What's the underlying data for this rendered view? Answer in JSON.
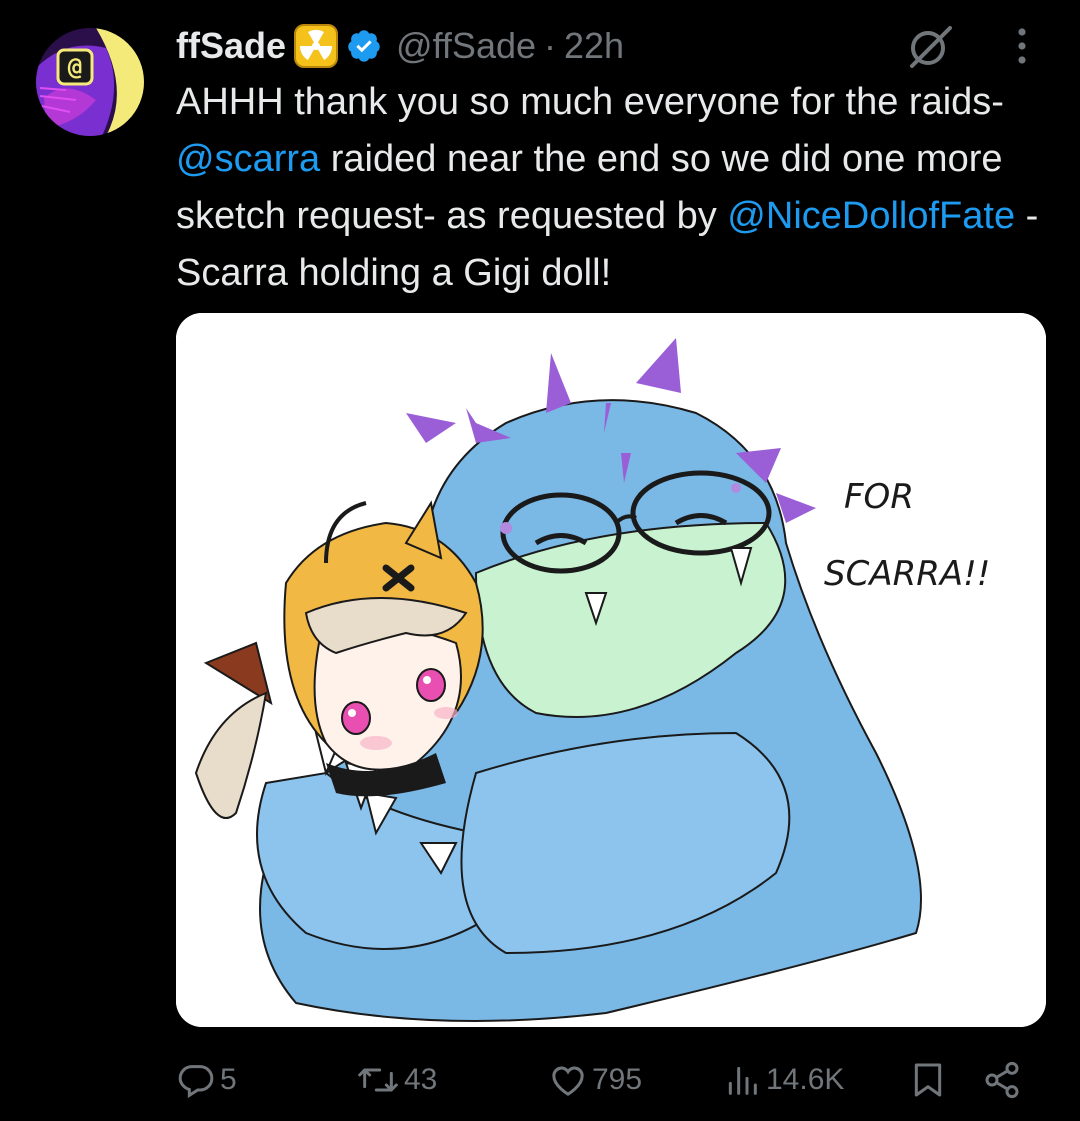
{
  "author": {
    "display_name": "ffSade",
    "handle": "@ffSade",
    "separator": "·",
    "time": "22h",
    "badge_icon": "radioactive-emoji-icon",
    "verified_icon": "verified-badge-icon",
    "avatar_colors": [
      "#f4ea7a",
      "#7a2fd0",
      "#2a0f4a"
    ]
  },
  "tweet": {
    "text_parts": [
      "AHHH thank you so much everyone for the raids-  ",
      "@scarra",
      " raided near the end so we did one more sketch request- as requested by ",
      "@NiceDollofFate",
      " - Scarra holding a Gigi doll!"
    ],
    "mention_color": "#1d9bf0"
  },
  "media": {
    "caption_line1": "FOR",
    "caption_line2": "SCARRA!!"
  },
  "actions": {
    "replies": "5",
    "retweets": "43",
    "likes": "795",
    "views": "14.6K",
    "bookmark_icon": "bookmark-icon",
    "share_icon": "share-icon"
  },
  "colors": {
    "background": "#000000",
    "text": "#e7e9ea",
    "muted": "#71767b",
    "accent": "#1d9bf0"
  }
}
